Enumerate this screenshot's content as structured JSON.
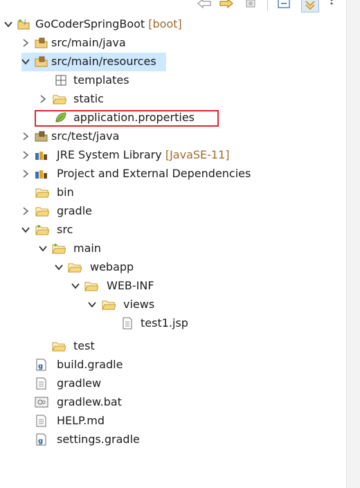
{
  "project": {
    "name": "GoCoderSpringBoot",
    "decoration": "[boot]"
  },
  "tree": {
    "src_main_java": "src/main/java",
    "src_main_resources": "src/main/resources",
    "templates": "templates",
    "static": "static",
    "application_properties": "application.properties",
    "src_test_java": "src/test/java",
    "jre_library": "JRE System Library",
    "jre_decoration": "[JavaSE-11]",
    "project_deps": "Project and External Dependencies",
    "bin": "bin",
    "gradle": "gradle",
    "src": "src",
    "main": "main",
    "webapp": "webapp",
    "web_inf": "WEB-INF",
    "views": "views",
    "test1_jsp": "test1.jsp",
    "test": "test",
    "build_gradle": "build.gradle",
    "gradlew": "gradlew",
    "gradlew_bat": "gradlew.bat",
    "help_md": "HELP.md",
    "settings_gradle": "settings.gradle"
  },
  "colors": {
    "selection": "#cde8ff",
    "highlight": "#e8212a",
    "decoration": "#a26a2b"
  }
}
